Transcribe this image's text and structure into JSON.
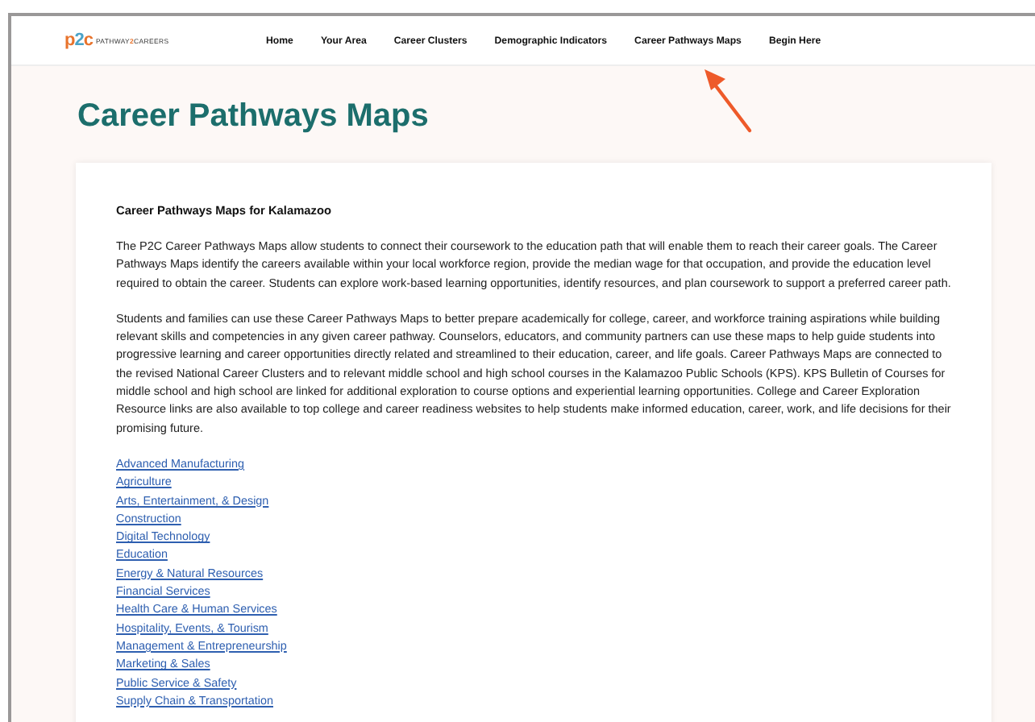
{
  "header": {
    "logo": {
      "mark": "p2c",
      "word_start": "PATHWAY",
      "word_mid": "2",
      "word_end": "CAREERS"
    },
    "nav": [
      "Home",
      "Your Area",
      "Career Clusters",
      "Demographic Indicators",
      "Career Pathways Maps",
      "Begin Here"
    ]
  },
  "page": {
    "title": "Career Pathways Maps"
  },
  "card": {
    "heading": "Career Pathways Maps for Kalamazoo",
    "paragraphs": [
      "The P2C Career Pathways Maps allow students to connect their coursework to the education path that will enable them to reach their career goals. The Career Pathways Maps identify the careers available within your local workforce region, provide the median wage for that occupation, and provide the education level required to obtain the career. Students can explore work-based learning opportunities, identify resources, and plan coursework to support a preferred career path.",
      "Students and families can use these Career Pathways Maps to better prepare academically for college, career, and workforce training aspirations while building relevant skills and competencies in any given career pathway. Counselors, educators, and community partners can use these maps to help guide students into progressive learning and career opportunities directly related and streamlined to their education, career, and life goals. Career Pathways Maps are connected to the revised National Career Clusters and to relevant middle school and high school courses in the Kalamazoo Public Schools (KPS). KPS Bulletin of Courses for middle school and high school are linked for additional exploration to course options and experiential learning opportunities. College and Career Exploration Resource links are also available to top college and career readiness websites to help students make informed education, career, work, and life decisions for their promising future."
    ],
    "links": [
      "Advanced Manufacturing",
      "Agriculture",
      "Arts, Entertainment, & Design",
      "Construction",
      "Digital Technology",
      "Education",
      "Energy & Natural Resources",
      "Financial Services",
      "Health Care & Human Services",
      "Hospitality, Events, & Tourism",
      "Management & Entrepreneurship",
      "Marketing & Sales",
      "Public Service & Safety",
      "Supply Chain & Transportation"
    ]
  }
}
